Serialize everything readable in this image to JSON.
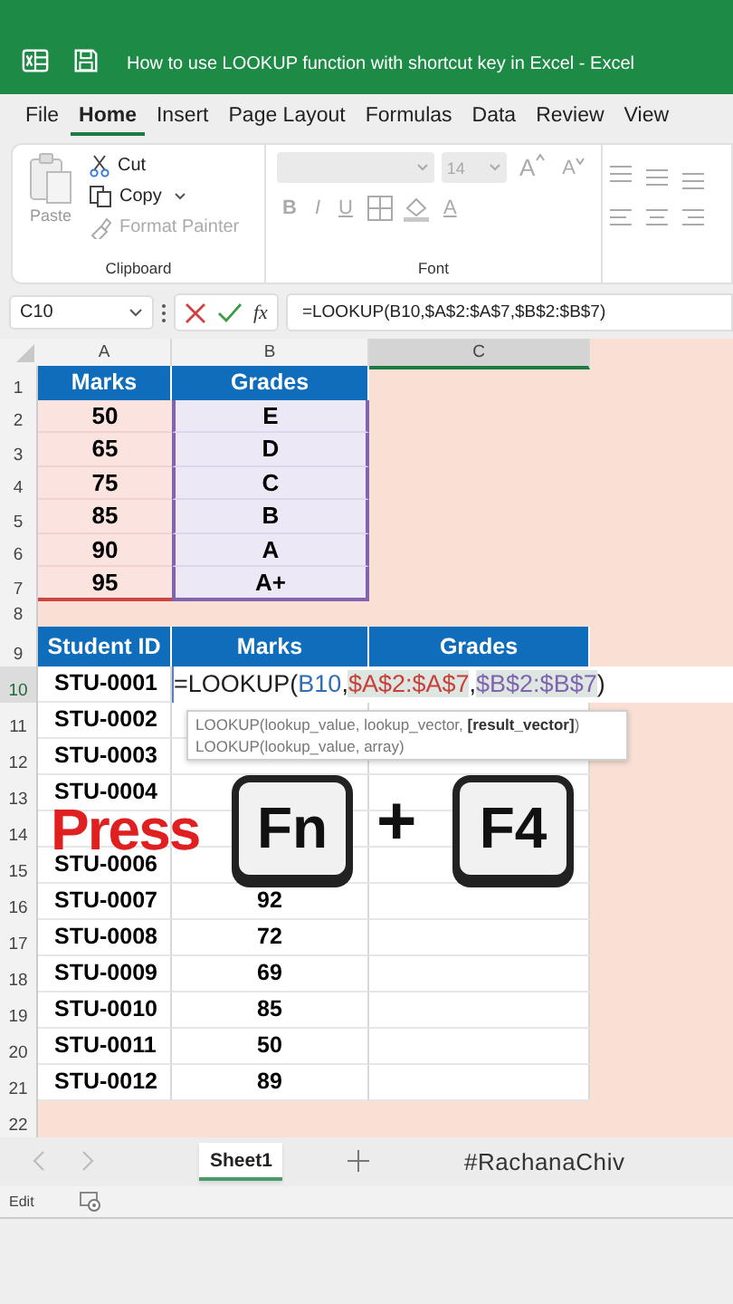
{
  "window": {
    "title": "How to use LOOKUP function with shortcut key in Excel  -  Excel"
  },
  "menu": [
    {
      "label": "File",
      "selected": false
    },
    {
      "label": "Home",
      "selected": true
    },
    {
      "label": "Insert",
      "selected": false
    },
    {
      "label": "Page Layout",
      "selected": false
    },
    {
      "label": "Formulas",
      "selected": false
    },
    {
      "label": "Data",
      "selected": false
    },
    {
      "label": "Review",
      "selected": false
    },
    {
      "label": "View",
      "selected": false
    }
  ],
  "clipboard": {
    "label": "Clipboard",
    "paste": {
      "label": "Paste",
      "disabled": true
    },
    "items": [
      {
        "kind": "cut",
        "label": "Cut",
        "disabled": false
      },
      {
        "kind": "copy",
        "label": "Copy",
        "disabled": false
      },
      {
        "kind": "format-painter",
        "label": "Format Painter",
        "disabled": true
      }
    ]
  },
  "font": {
    "label": "Font",
    "disabled": true,
    "size": "14",
    "row1": [
      {
        "kind": "grow",
        "label": "A"
      },
      {
        "kind": "shrink",
        "label": "A"
      }
    ],
    "row2": [
      {
        "kind": "bold",
        "label": "B"
      },
      {
        "kind": "italic",
        "label": "I"
      },
      {
        "kind": "underline",
        "label": "U"
      },
      {
        "kind": "borders"
      },
      {
        "kind": "fill"
      },
      {
        "kind": "font-color",
        "label": "A"
      }
    ]
  },
  "formula_bar": {
    "name_box": "C10",
    "fx_label": "fx",
    "formula": "=LOOKUP(B10,$A$2:$A$7,$B$2:$B$7)"
  },
  "sheet": {
    "columns": [
      {
        "label": "A",
        "selected": false
      },
      {
        "label": "B",
        "selected": false
      },
      {
        "label": "C",
        "selected": true
      }
    ],
    "rows": [
      {
        "number": "1",
        "kind": "header",
        "selected": false,
        "cells": [
          "Marks",
          "Grades"
        ]
      },
      {
        "number": "2",
        "kind": "lookup",
        "selected": false,
        "cells": [
          "50",
          "E"
        ]
      },
      {
        "number": "3",
        "kind": "lookup",
        "selected": false,
        "cells": [
          "65",
          "D"
        ]
      },
      {
        "number": "4",
        "kind": "lookup",
        "selected": false,
        "cells": [
          "75",
          "C"
        ]
      },
      {
        "number": "5",
        "kind": "lookup",
        "selected": false,
        "cells": [
          "85",
          "B"
        ]
      },
      {
        "number": "6",
        "kind": "lookup",
        "selected": false,
        "cells": [
          "90",
          "A"
        ]
      },
      {
        "number": "7",
        "kind": "lookup",
        "selected": false,
        "cells": [
          "95",
          "A+"
        ]
      },
      {
        "number": "8",
        "kind": "blank",
        "selected": false
      },
      {
        "number": "9",
        "kind": "header",
        "selected": false,
        "cells": [
          "Student ID",
          "Marks",
          "Grades"
        ]
      },
      {
        "number": "10",
        "kind": "active",
        "selected": true,
        "cells": [
          "STU-0001"
        ],
        "formula_parts": [
          {
            "text": "=LOOKUP(",
            "color": "#1f1f1f"
          },
          {
            "text": "B10",
            "color": "#2f6db5"
          },
          {
            "text": ",",
            "color": "#1f1f1f"
          },
          {
            "text": "$A$2:$A$7",
            "color": "#c8403a"
          },
          {
            "text": ",",
            "color": "#1f1f1f"
          },
          {
            "text": "$B$2:$B$7",
            "color": "#8064b0"
          },
          {
            "text": ")",
            "color": "#1f1f1f"
          }
        ]
      },
      {
        "number": "11",
        "kind": "student",
        "selected": false,
        "cells": [
          "STU-0002"
        ]
      },
      {
        "number": "12",
        "kind": "student",
        "selected": false,
        "cells": [
          "STU-0003"
        ]
      },
      {
        "number": "13",
        "kind": "student",
        "selected": false,
        "cells": [
          "STU-0004"
        ]
      },
      {
        "number": "14",
        "kind": "student",
        "selected": false,
        "cells": []
      },
      {
        "number": "15",
        "kind": "student",
        "selected": false,
        "cells": [
          "STU-0006"
        ]
      },
      {
        "number": "16",
        "kind": "student",
        "selected": false,
        "cells": [
          "STU-0007",
          "92"
        ]
      },
      {
        "number": "17",
        "kind": "student",
        "selected": false,
        "cells": [
          "STU-0008",
          "72"
        ]
      },
      {
        "number": "18",
        "kind": "student",
        "selected": false,
        "cells": [
          "STU-0009",
          "69"
        ]
      },
      {
        "number": "19",
        "kind": "student",
        "selected": false,
        "cells": [
          "STU-0010",
          "85"
        ]
      },
      {
        "number": "20",
        "kind": "student",
        "selected": false,
        "cells": [
          "STU-0011",
          "50"
        ]
      },
      {
        "number": "21",
        "kind": "student",
        "selected": false,
        "cells": [
          "STU-0012",
          "89"
        ]
      },
      {
        "number": "22",
        "kind": "blank",
        "selected": false
      }
    ]
  },
  "tooltip": {
    "lines": [
      "LOOKUP(lookup_value, lookup_vector, **[result_vector]**)",
      "LOOKUP(lookup_value, array)"
    ]
  },
  "overlay": {
    "caption": "Press",
    "keys": [
      "Fn",
      "F4"
    ],
    "joiner": "+"
  },
  "sheet_tabs": {
    "tabs": [
      {
        "label": "Sheet1",
        "selected": true
      }
    ],
    "hashtag": "#RachanaChiv"
  },
  "status_bar": {
    "mode": "Edit"
  }
}
